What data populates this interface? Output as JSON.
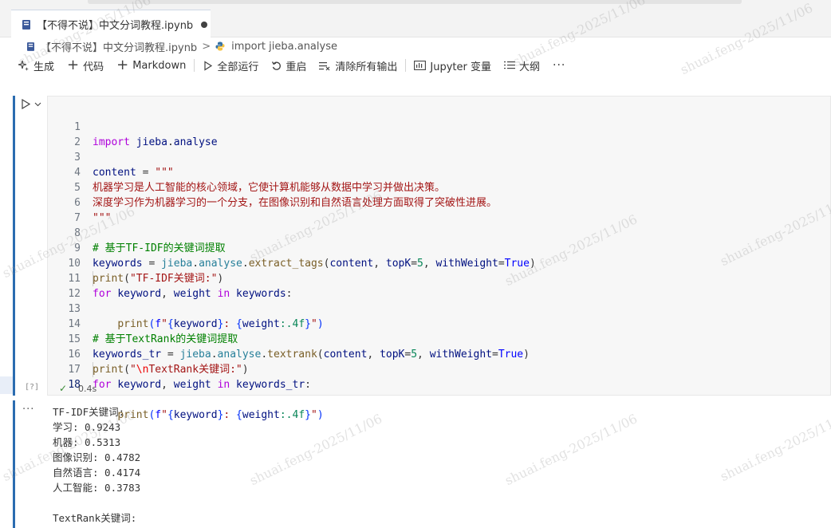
{
  "tab": {
    "title": "【不得不说】中文分词教程.ipynb"
  },
  "breadcrumb": {
    "file": "【不得不说】中文分词教程.ipynb",
    "separator": ">",
    "symbol": "import jieba.analyse"
  },
  "toolbar": {
    "generate": "生成",
    "code": "代码",
    "markdown": "Markdown",
    "run_all": "全部运行",
    "restart": "重启",
    "clear_outputs": "清除所有输出",
    "variables": "Jupyter 变量",
    "outline": "大纲",
    "more": "···"
  },
  "cell": {
    "exec_count": "[?]",
    "duration": "0.4s",
    "line_numbers": [
      "1",
      "2",
      "3",
      "4",
      "5",
      "6",
      "7",
      "8",
      "9",
      "10",
      "11",
      "12",
      "13",
      "14",
      "15",
      "16",
      "17",
      "18"
    ]
  },
  "code": {
    "l1_kw": "import",
    "l1_mod": "jieba",
    "l1_dot": ".",
    "l1_sub": "analyse",
    "l3_var": "content",
    "l3_eq": " = ",
    "l3_str": "\"\"\"",
    "l4": "机器学习是人工智能的核心领域，它使计算机能够从数据中学习并做出决策。",
    "l5": "深度学习作为机器学习的一个分支，在图像识别和自然语言处理方面取得了突破性进展。",
    "l6": "\"\"\"",
    "l8": "# 基于TF-IDF的关键词提取",
    "l9_var": "keywords",
    "l9_eq": " = ",
    "l9_mod": "jieba",
    "l9_sub": "analyse",
    "l9_fn": "extract_tags",
    "l9_arg1": "content",
    "l9_arg2": "topK",
    "l9_num": "5",
    "l9_arg3": "withWeight",
    "l9_true": "True",
    "l10_fn": "print",
    "l10_str": "\"TF-IDF关键词:\"",
    "l11_for": "for",
    "l11_v1": "keyword",
    "l11_v2": "weight",
    "l11_in": "in",
    "l11_v3": "keywords",
    "l12_fn": "print",
    "l12_pre": "f\"",
    "l12_v1": "keyword",
    "l12_mid": ": ",
    "l12_v2": "weight",
    "l12_fmt": ":.4f",
    "l12_end": "\"",
    "l14": "# 基于TextRank的关键词提取",
    "l15_var": "keywords_tr",
    "l15_eq": " = ",
    "l15_mod": "jieba",
    "l15_sub": "analyse",
    "l15_fn": "textrank",
    "l15_arg1": "content",
    "l15_arg2": "topK",
    "l15_num": "5",
    "l15_arg3": "withWeight",
    "l15_true": "True",
    "l16_fn": "print",
    "l16_q1": "\"",
    "l16_esc": "\\n",
    "l16_rest": "TextRank关键词:\"",
    "l17_for": "for",
    "l17_v1": "keyword",
    "l17_v2": "weight",
    "l17_in": "in",
    "l17_v3": "keywords_tr",
    "l18_fn": "print",
    "l18_pre": "f\"",
    "l18_v1": "keyword",
    "l18_mid": ": ",
    "l18_v2": "weight",
    "l18_fmt": ":.4f",
    "l18_end": "\""
  },
  "output": {
    "dots": "···",
    "lines": [
      "TF-IDF关键词:",
      "学习: 0.9243",
      "机器: 0.5313",
      "图像识别: 0.4782",
      "自然语言: 0.4174",
      "人工智能: 0.3783",
      "",
      "TextRank关键词:"
    ]
  },
  "watermark": "shuai.feng-2025/11/06"
}
